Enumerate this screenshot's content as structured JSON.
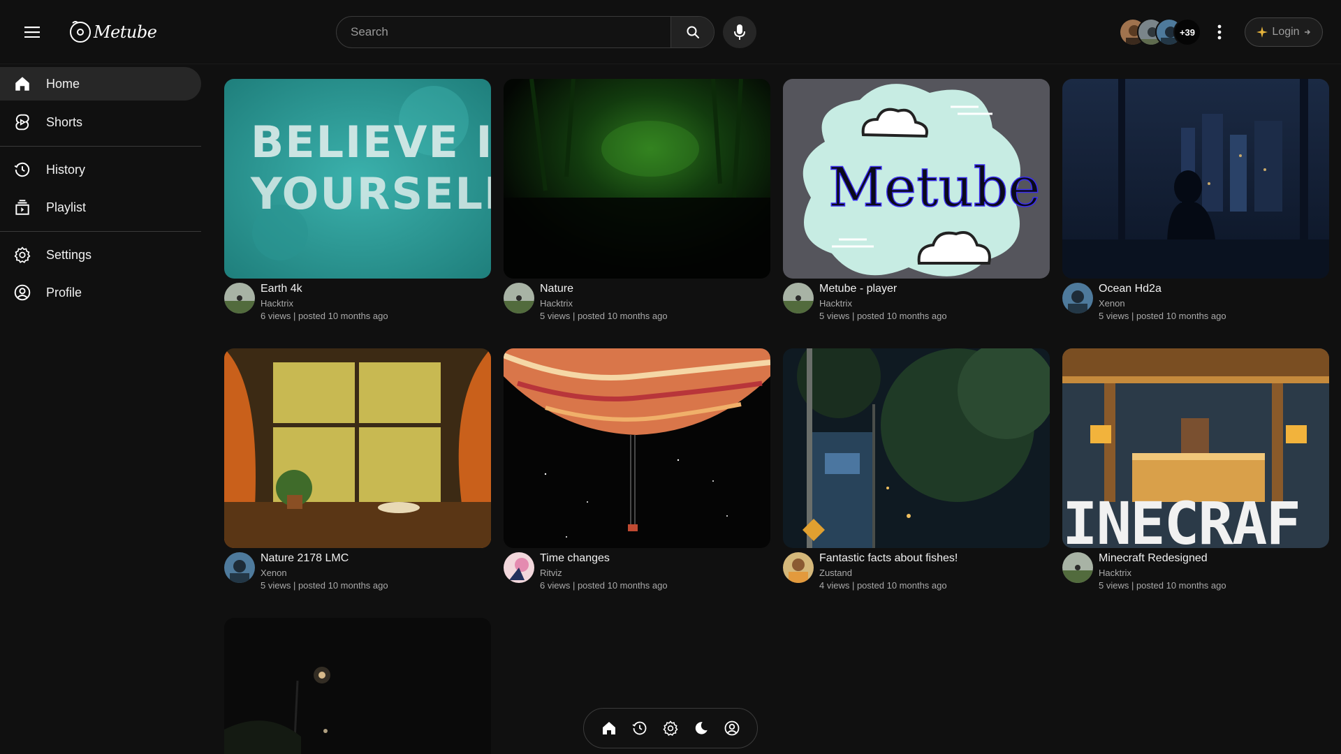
{
  "app": {
    "logo_text": "Metube"
  },
  "header": {
    "search_placeholder": "Search",
    "viewers_extra": "+39",
    "login_label": "Login"
  },
  "sidebar": {
    "items": [
      {
        "label": "Home",
        "icon": "home-icon",
        "active": true
      },
      {
        "label": "Shorts",
        "icon": "shorts-icon"
      },
      {
        "label": "History",
        "icon": "history-icon"
      },
      {
        "label": "Playlist",
        "icon": "playlist-icon"
      },
      {
        "label": "Settings",
        "icon": "settings-icon"
      },
      {
        "label": "Profile",
        "icon": "profile-icon"
      }
    ]
  },
  "videos": [
    {
      "title": "Earth 4k",
      "channel": "Hacktrix",
      "stats": "6 views | posted 10 months ago",
      "thumb_text": "BELIEVE IN YOURSELF"
    },
    {
      "title": "Nature",
      "channel": "Hacktrix",
      "stats": "5 views | posted 10 months ago"
    },
    {
      "title": "Metube - player",
      "channel": "Hacktrix",
      "stats": "5 views | posted 10 months ago",
      "thumb_text": "Metube"
    },
    {
      "title": "Ocean Hd2a",
      "channel": "Xenon",
      "stats": "5 views | posted 10 months ago"
    },
    {
      "title": "Nature 2178 LMC",
      "channel": "Xenon",
      "stats": "5 views | posted 10 months ago"
    },
    {
      "title": "Time changes",
      "channel": "Ritviz",
      "stats": "6 views | posted 10 months ago"
    },
    {
      "title": "Fantastic facts about fishes!",
      "channel": "Zustand",
      "stats": "4 views | posted 10 months ago"
    },
    {
      "title": "Minecraft Redesigned",
      "channel": "Hacktrix",
      "stats": "5 views | posted 10 months ago",
      "thumb_text": "INECRAF"
    }
  ],
  "colors": {
    "background": "#101010",
    "accent_teal": "#2e9c98",
    "sidebar_active": "#272727",
    "metube_cloud": "#c7ece3",
    "metube_card_bg": "#55555c"
  }
}
